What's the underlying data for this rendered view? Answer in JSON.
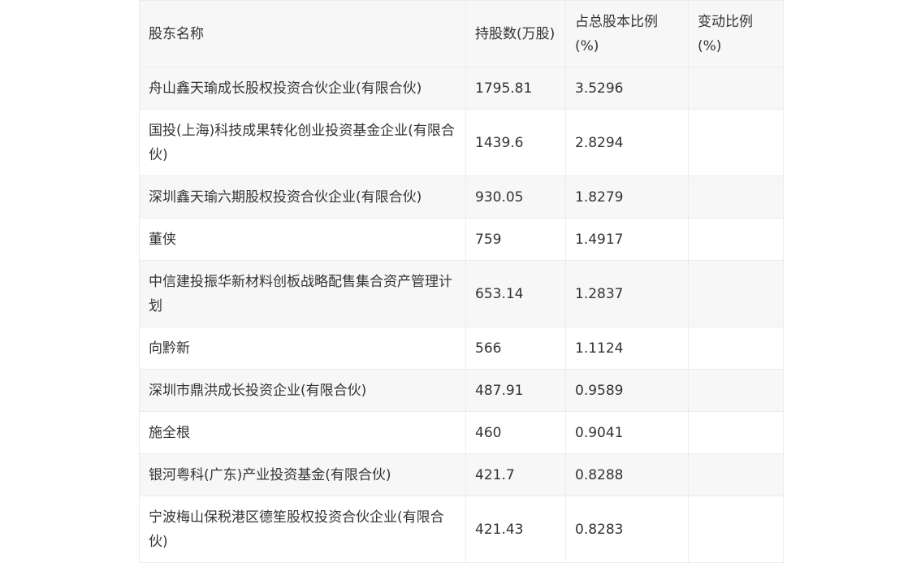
{
  "table": {
    "headers": [
      "股东名称",
      "持股数(万股)",
      "占总股本比例(%)",
      "变动比例(%)"
    ],
    "rows": [
      {
        "name": "舟山鑫天瑜成长股权投资合伙企业(有限合伙)",
        "shares": "1795.81",
        "ratio": "3.5296",
        "change": ""
      },
      {
        "name": "国投(上海)科技成果转化创业投资基金企业(有限合伙)",
        "shares": "1439.6",
        "ratio": "2.8294",
        "change": ""
      },
      {
        "name": "深圳鑫天瑜六期股权投资合伙企业(有限合伙)",
        "shares": "930.05",
        "ratio": "1.8279",
        "change": ""
      },
      {
        "name": "董侠",
        "shares": "759",
        "ratio": "1.4917",
        "change": ""
      },
      {
        "name": "中信建投振华新材料创板战略配售集合资产管理计划",
        "shares": "653.14",
        "ratio": "1.2837",
        "change": ""
      },
      {
        "name": "向黔新",
        "shares": "566",
        "ratio": "1.1124",
        "change": ""
      },
      {
        "name": "深圳市鼎洪成长投资企业(有限合伙)",
        "shares": "487.91",
        "ratio": "0.9589",
        "change": ""
      },
      {
        "name": "施全根",
        "shares": "460",
        "ratio": "0.9041",
        "change": ""
      },
      {
        "name": "银河粤科(广东)产业投资基金(有限合伙)",
        "shares": "421.7",
        "ratio": "0.8288",
        "change": ""
      },
      {
        "name": "宁波梅山保税港区德笙股权投资合伙企业(有限合伙)",
        "shares": "421.43",
        "ratio": "0.8283",
        "change": ""
      }
    ]
  }
}
